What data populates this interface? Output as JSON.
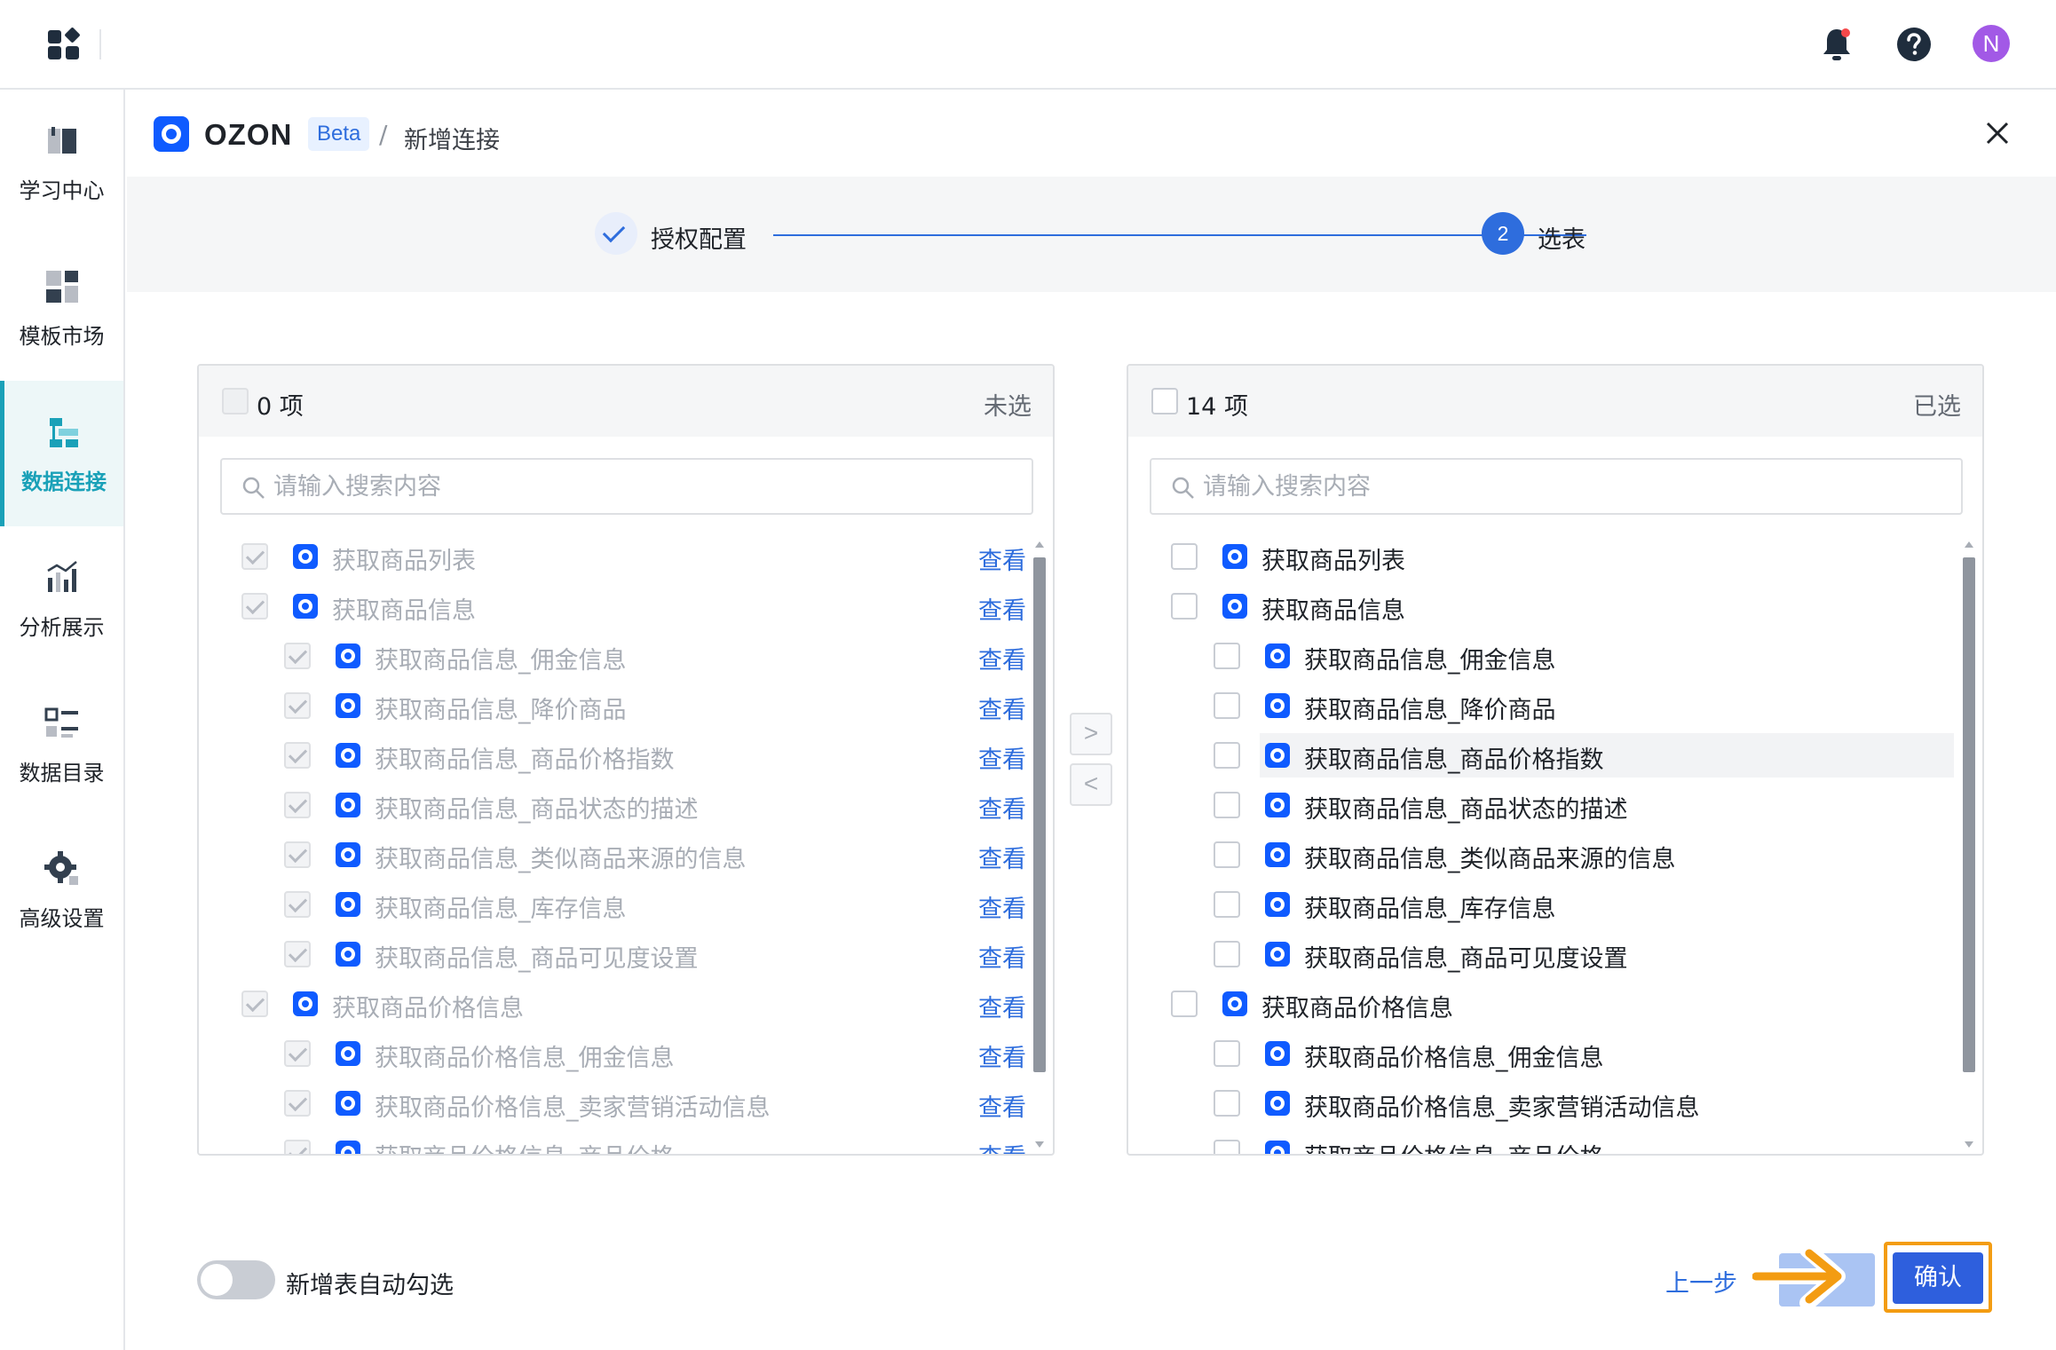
{
  "topbar": {
    "avatar_initial": "N"
  },
  "sidebar": {
    "items": [
      {
        "label": "学习中心",
        "icon": "book-icon"
      },
      {
        "label": "模板市场",
        "icon": "template-icon"
      },
      {
        "label": "数据连接",
        "icon": "data-connect-icon",
        "active": true
      },
      {
        "label": "分析展示",
        "icon": "chart-icon"
      },
      {
        "label": "数据目录",
        "icon": "catalog-icon"
      },
      {
        "label": "高级设置",
        "icon": "gear-icon"
      }
    ]
  },
  "header": {
    "brand": "OZON",
    "badge": "Beta",
    "separator": "/",
    "title": "新增连接"
  },
  "stepper": {
    "step1": "授权配置",
    "step2_number": "2",
    "step2": "选表"
  },
  "left_panel": {
    "count": "0 项",
    "status": "未选",
    "search_placeholder": "请输入搜索内容",
    "view_label": "查看",
    "rows": [
      {
        "name": "获取商品列表",
        "level": 0
      },
      {
        "name": "获取商品信息",
        "level": 0
      },
      {
        "name": "获取商品信息_佣金信息",
        "level": 1
      },
      {
        "name": "获取商品信息_降价商品",
        "level": 1
      },
      {
        "name": "获取商品信息_商品价格指数",
        "level": 1
      },
      {
        "name": "获取商品信息_商品状态的描述",
        "level": 1
      },
      {
        "name": "获取商品信息_类似商品来源的信息",
        "level": 1
      },
      {
        "name": "获取商品信息_库存信息",
        "level": 1
      },
      {
        "name": "获取商品信息_商品可见度设置",
        "level": 1
      },
      {
        "name": "获取商品价格信息",
        "level": 0
      },
      {
        "name": "获取商品价格信息_佣金信息",
        "level": 1
      },
      {
        "name": "获取商品价格信息_卖家营销活动信息",
        "level": 1
      },
      {
        "name": "获取商品价格信息_商品价格",
        "level": 1
      }
    ]
  },
  "right_panel": {
    "count": "14 项",
    "status": "已选",
    "search_placeholder": "请输入搜索内容",
    "rows": [
      {
        "name": "获取商品列表",
        "level": 0
      },
      {
        "name": "获取商品信息",
        "level": 0
      },
      {
        "name": "获取商品信息_佣金信息",
        "level": 1
      },
      {
        "name": "获取商品信息_降价商品",
        "level": 1
      },
      {
        "name": "获取商品信息_商品价格指数",
        "level": 1,
        "highlight": true
      },
      {
        "name": "获取商品信息_商品状态的描述",
        "level": 1
      },
      {
        "name": "获取商品信息_类似商品来源的信息",
        "level": 1
      },
      {
        "name": "获取商品信息_库存信息",
        "level": 1
      },
      {
        "name": "获取商品信息_商品可见度设置",
        "level": 1
      },
      {
        "name": "获取商品价格信息",
        "level": 0
      },
      {
        "name": "获取商品价格信息_佣金信息",
        "level": 1
      },
      {
        "name": "获取商品价格信息_卖家营销活动信息",
        "level": 1
      },
      {
        "name": "获取商品价格信息_商品价格",
        "level": 1
      }
    ]
  },
  "transfer": {
    "to_right": ">",
    "to_left": "<"
  },
  "footer": {
    "toggle_label": "新增表自动勾选",
    "toggle_on": false,
    "prev": "上一步",
    "confirm": "确认"
  },
  "colors": {
    "primary": "#2e6ddd",
    "accent_teal": "#1aa1b8",
    "highlight_orange": "#f39c12",
    "ozon_blue": "#0f5bff"
  }
}
